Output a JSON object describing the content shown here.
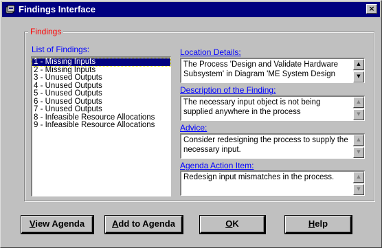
{
  "window": {
    "title": "Findings Interface",
    "close_glyph": "×"
  },
  "group": {
    "legend": "Findings",
    "list_label": "List of Findings:"
  },
  "findings": [
    "1 - Missing Inputs",
    "2 - Missing Inputs",
    "3 - Unused Outputs",
    "4 - Unused Outputs",
    "5 - Unused Outputs",
    "6 - Unused Outputs",
    "7 - Unused Outputs",
    "8 - Infeasible Resource Allocations",
    "9 - Infeasible Resource Allocations"
  ],
  "selected_index": 0,
  "details": {
    "location": {
      "label": "Location Details:",
      "text": "The Process 'Design and Validate Hardware Subsystem' in Diagram 'ME System Design"
    },
    "description": {
      "label": "Description of the Finding:",
      "text": "The necessary input object is not being supplied anywhere in the process"
    },
    "advice": {
      "label": "Advice:",
      "text": "Consider redesigning the process to supply the necessary input."
    },
    "agenda": {
      "label": "Agenda Action Item:",
      "text": "Redesign input mismatches in the process."
    }
  },
  "buttons": {
    "view_agenda": {
      "mnemonic": "V",
      "rest": "iew Agenda"
    },
    "add_to_agenda": {
      "mnemonic": "A",
      "rest": "dd to Agenda"
    },
    "ok": {
      "mnemonic": "O",
      "rest": "K"
    },
    "help": {
      "mnemonic": "H",
      "rest": "elp"
    }
  },
  "colors": {
    "titlebar": "#000080",
    "legend": "#ff0000",
    "labels": "#0000ff",
    "selection": "#000080"
  }
}
